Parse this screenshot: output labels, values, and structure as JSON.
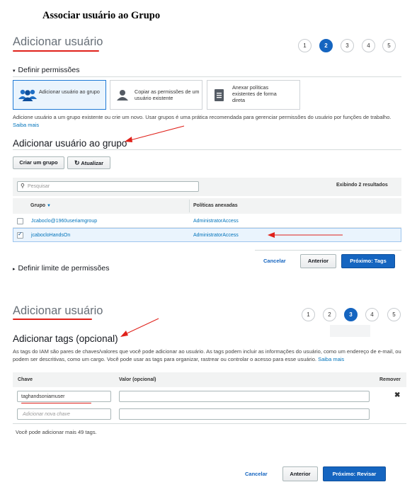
{
  "doc_title": "Associar usuário ao Grupo",
  "panel1": {
    "title": "Adicionar usuário",
    "steps": [
      "1",
      "2",
      "3",
      "4",
      "5"
    ],
    "active_step": 2,
    "permissions_toggle": "Definir permissões",
    "options": [
      {
        "label": "Adicionar usuário ao grupo",
        "icon": "users-icon"
      },
      {
        "label": "Copiar as permissões de um usuário existente",
        "icon": "user-icon"
      },
      {
        "label": "Anexar políticas existentes de forma direta",
        "icon": "document-icon"
      }
    ],
    "description": "Adicione usuário a um grupo existente ou crie um novo. Usar grupos é uma prática recomendada para gerenciar permissões do usuário por funções de trabalho.",
    "learn_more": "Saiba mais",
    "section_heading": "Adicionar usuário ao grupo",
    "create_group_button": "Criar um grupo",
    "refresh_button": "Atualizar",
    "search_placeholder": "Pesquisar",
    "results_text": "Exibindo 2 resultados",
    "columns": [
      "Grupo",
      "Políticas anexadas"
    ],
    "rows": [
      {
        "group": "Jcaboclo@1960useriamgroup",
        "policy": "AdministratorAccess",
        "checked": false
      },
      {
        "group": "jcabocloHandsOn",
        "policy": "AdministratorAccess",
        "checked": true
      }
    ],
    "boundary_toggle": "Definir limite de permissões",
    "cancel": "Cancelar",
    "previous": "Anterior",
    "next": "Próximo: Tags"
  },
  "panel2": {
    "title": "Adicionar usuário",
    "steps": [
      "1",
      "2",
      "3",
      "4",
      "5"
    ],
    "active_step": 3,
    "section_heading": "Adicionar tags (opcional)",
    "description": "As tags do IAM são pares de chaves/valores que você pode adicionar ao usuário. As tags podem incluir as informações do usuário, como um endereço de e-mail, ou podem ser descritivas, como um cargo. Você pode usar as tags para organizar, rastrear ou controlar o acesso para esse usuário.",
    "learn_more": "Saiba mais",
    "columns": [
      "Chave",
      "Valor (opcional)",
      "Remover"
    ],
    "tag_key_value": "taghandsoniamuser",
    "tag_value": "",
    "new_key_placeholder": "Adicionar nova chave",
    "remaining_text": "Você pode adicionar mais 49 tags.",
    "cancel": "Cancelar",
    "previous": "Anterior",
    "next": "Próximo: Revisar"
  },
  "colors": {
    "accent": "#1565c0",
    "annotation": "#e0211a"
  }
}
